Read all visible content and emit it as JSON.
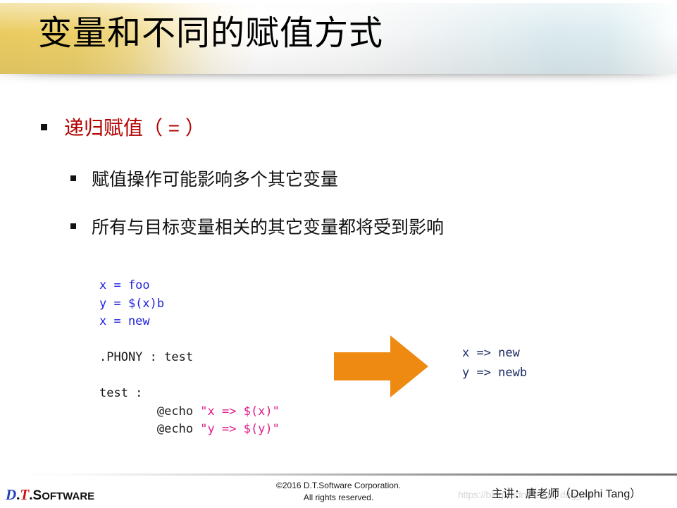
{
  "slide": {
    "title": "变量和不同的赋值方式",
    "accent_gold": "#e9c856",
    "accent_blue_tint": "#d8e9ef",
    "heading_red": "#b30000",
    "arrow_orange": "#ee8a12",
    "code_blue": "#2222dd",
    "code_pink": "#e01b8c",
    "code_dark": "#1a1a1a",
    "output_navy": "#1b2a63"
  },
  "content": {
    "level1": {
      "bullet_glyph": "square-bullet",
      "text": "递归赋值（ = ）"
    },
    "level2": [
      {
        "bullet_glyph": "square-bullet",
        "text": "赋值操作可能影响多个其它变量"
      },
      {
        "bullet_glyph": "square-bullet",
        "text": "所有与目标变量相关的其它变量都将受到影响"
      }
    ]
  },
  "code_left": {
    "lines": [
      {
        "segments": [
          {
            "text": "x = foo",
            "color": "blue"
          }
        ]
      },
      {
        "segments": [
          {
            "text": "y = $(x)b",
            "color": "blue"
          }
        ]
      },
      {
        "segments": [
          {
            "text": "x = new",
            "color": "blue"
          }
        ]
      },
      {
        "blank": true
      },
      {
        "segments": [
          {
            "text": ".PHONY : test",
            "color": "dark"
          }
        ]
      },
      {
        "blank": true
      },
      {
        "segments": [
          {
            "text": "test :",
            "color": "dark"
          }
        ]
      },
      {
        "segments": [
          {
            "text": "        @echo ",
            "color": "dark"
          },
          {
            "text": "\"x => $(x)\"",
            "color": "pink"
          }
        ]
      },
      {
        "segments": [
          {
            "text": "        @echo ",
            "color": "dark"
          },
          {
            "text": "\"y => $(y)\"",
            "color": "pink"
          }
        ]
      }
    ]
  },
  "code_right": {
    "lines": [
      "x => new",
      "y => newb"
    ]
  },
  "arrow": {
    "icon_name": "right-arrow-icon",
    "direction": "right",
    "color": "#ee8a12"
  },
  "footer": {
    "logo": {
      "d": "D",
      "dot1": ".",
      "t": "T",
      "dot2": ".",
      "software_cap": "S",
      "software_rest": "OFTWARE"
    },
    "copyright_line1": "©2016 D.T.Software Corporation.",
    "copyright_line2": "All rights reserved.",
    "presenter": "主讲：唐老师（Delphi Tang）",
    "watermark": "https://blog.csdn.net/qq_doggod"
  }
}
